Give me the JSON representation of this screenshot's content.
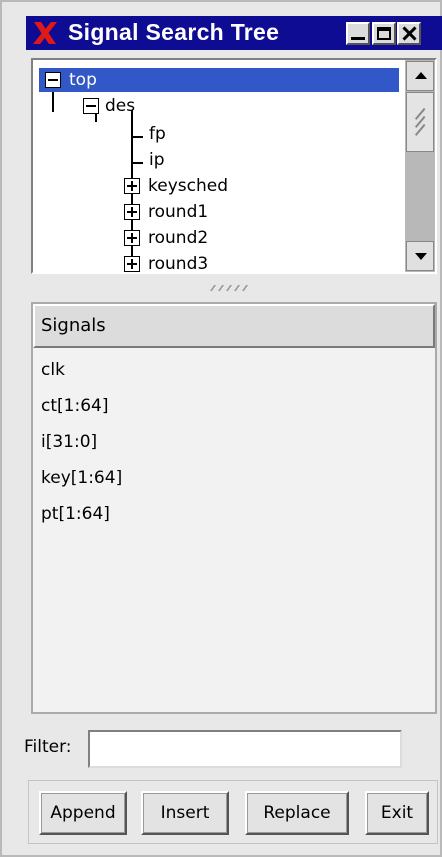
{
  "window": {
    "title": "Signal Search Tree"
  },
  "tree": {
    "nodes": [
      {
        "label": "top",
        "expander": "minus",
        "selected": true
      },
      {
        "label": "des",
        "expander": "minus"
      },
      {
        "label": "fp"
      },
      {
        "label": "ip"
      },
      {
        "label": "keysched",
        "expander": "plus"
      },
      {
        "label": "round1",
        "expander": "plus"
      },
      {
        "label": "round2",
        "expander": "plus"
      },
      {
        "label": "round3",
        "expander": "plus"
      }
    ]
  },
  "signals": {
    "header": "Signals",
    "items": [
      "clk",
      "ct[1:64]",
      "i[31:0]",
      "key[1:64]",
      "pt[1:64]"
    ]
  },
  "filter": {
    "label": "Filter:",
    "value": ""
  },
  "buttons": {
    "append": "Append",
    "insert": "Insert",
    "replace": "Replace",
    "exit": "Exit"
  },
  "colors": {
    "titlebar": "#0f0c94",
    "selection": "#3257c6",
    "logo": "#e01818"
  }
}
